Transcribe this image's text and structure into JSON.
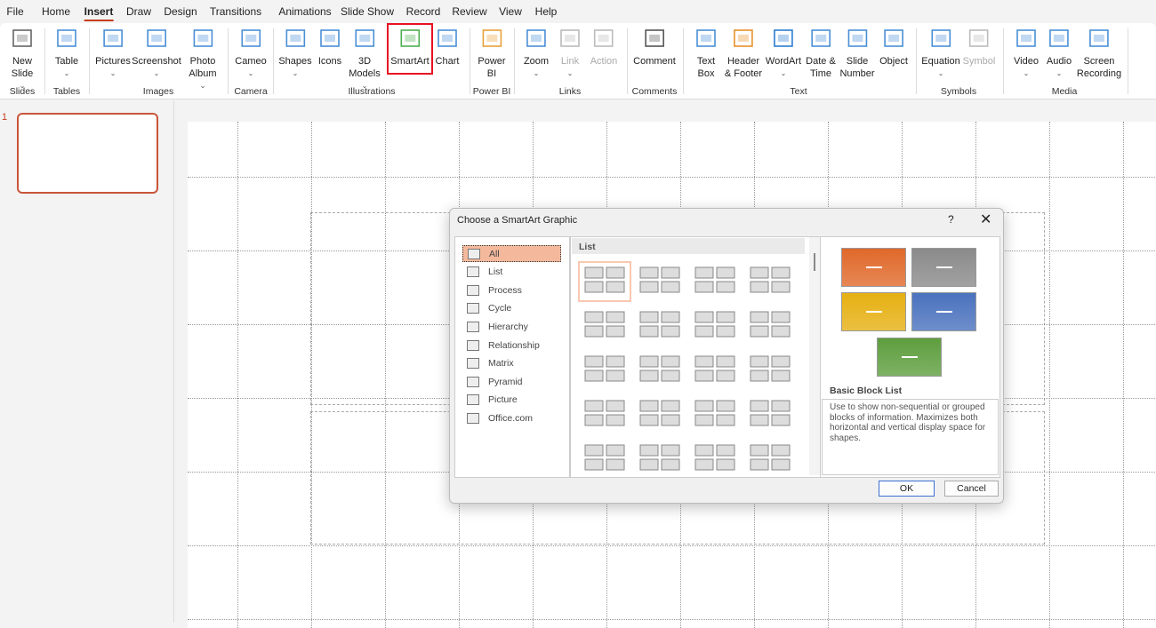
{
  "menu": {
    "tabs": [
      "File",
      "Home",
      "Insert",
      "Draw",
      "Design",
      "Transitions",
      "Animations",
      "Slide Show",
      "Record",
      "Review",
      "View",
      "Help"
    ],
    "active": "Insert"
  },
  "ribbon": {
    "buttons": [
      {
        "id": "new-slide",
        "label": "New",
        "label2": "Slide",
        "dropdown": true,
        "icon": "new-slide-icon"
      },
      {
        "id": "table",
        "label": "Table",
        "dropdown": true,
        "icon": "table-icon"
      },
      {
        "id": "pictures",
        "label": "Pictures",
        "dropdown": true,
        "icon": "pictures-icon"
      },
      {
        "id": "screenshot",
        "label": "Screenshot",
        "dropdown": true,
        "icon": "screenshot-icon"
      },
      {
        "id": "photo-album",
        "label": "Photo",
        "label2": "Album",
        "dropdown": true,
        "icon": "photo-album-icon"
      },
      {
        "id": "cameo",
        "label": "Cameo",
        "dropdown": true,
        "icon": "cameo-icon"
      },
      {
        "id": "shapes",
        "label": "Shapes",
        "dropdown": true,
        "icon": "shapes-icon"
      },
      {
        "id": "icons",
        "label": "Icons",
        "icon": "icons-icon"
      },
      {
        "id": "3d-models",
        "label": "3D",
        "label2": "Models",
        "dropdown": true,
        "icon": "cube-icon"
      },
      {
        "id": "smartart",
        "label": "SmartArt",
        "icon": "smartart-icon"
      },
      {
        "id": "chart",
        "label": "Chart",
        "icon": "chart-icon"
      },
      {
        "id": "power-bi",
        "label": "Power",
        "label2": "BI",
        "icon": "power-bi-icon"
      },
      {
        "id": "zoom",
        "label": "Zoom",
        "dropdown": true,
        "icon": "zoom-icon"
      },
      {
        "id": "link",
        "label": "Link",
        "dropdown": true,
        "disabled": true,
        "icon": "link-icon"
      },
      {
        "id": "action",
        "label": "Action",
        "disabled": true,
        "icon": "star-icon"
      },
      {
        "id": "comment",
        "label": "Comment",
        "icon": "comment-icon"
      },
      {
        "id": "text-box",
        "label": "Text",
        "label2": "Box",
        "icon": "text-box-icon"
      },
      {
        "id": "header-footer",
        "label": "Header",
        "label2": "& Footer",
        "icon": "header-footer-icon"
      },
      {
        "id": "wordart",
        "label": "WordArt",
        "dropdown": true,
        "icon": "wordart-icon"
      },
      {
        "id": "date-time",
        "label": "Date &",
        "label2": "Time",
        "icon": "calendar-icon"
      },
      {
        "id": "slide-number",
        "label": "Slide",
        "label2": "Number",
        "icon": "slide-number-icon"
      },
      {
        "id": "object",
        "label": "Object",
        "icon": "object-icon"
      },
      {
        "id": "equation",
        "label": "Equation",
        "dropdown": true,
        "icon": "pi-icon"
      },
      {
        "id": "symbol",
        "label": "Symbol",
        "disabled": true,
        "icon": "omega-icon"
      },
      {
        "id": "video",
        "label": "Video",
        "dropdown": true,
        "icon": "video-icon"
      },
      {
        "id": "audio",
        "label": "Audio",
        "dropdown": true,
        "icon": "speaker-icon"
      },
      {
        "id": "screen-recording",
        "label": "Screen",
        "label2": "Recording",
        "icon": "screen-recording-icon"
      }
    ],
    "groups": [
      "Slides",
      "Tables",
      "Images",
      "Camera",
      "Illustrations",
      "Power BI",
      "Links",
      "Comments",
      "Text",
      "Symbols",
      "Media"
    ],
    "highlighted": "SmartArt",
    "highlight_color": "#e81123"
  },
  "slides_panel": {
    "slide_number": "1",
    "accent": "#c9553a"
  },
  "dialog": {
    "title": "Choose a SmartArt Graphic",
    "help": "?",
    "close": "✕",
    "categories": [
      "All",
      "List",
      "Process",
      "Cycle",
      "Hierarchy",
      "Relationship",
      "Matrix",
      "Pyramid",
      "Picture",
      "Office.com"
    ],
    "selected_category": "All",
    "list_header": "List",
    "preview": {
      "name": "Basic Block List",
      "description": "Use to show non-sequential or grouped blocks of information. Maximizes both horizontal and vertical display space for shapes.",
      "colors": [
        "#e0692a",
        "#8a8a8a",
        "#e6b012",
        "#4a72be",
        "#5e9e3e"
      ]
    },
    "ok": "OK",
    "cancel": "Cancel"
  }
}
